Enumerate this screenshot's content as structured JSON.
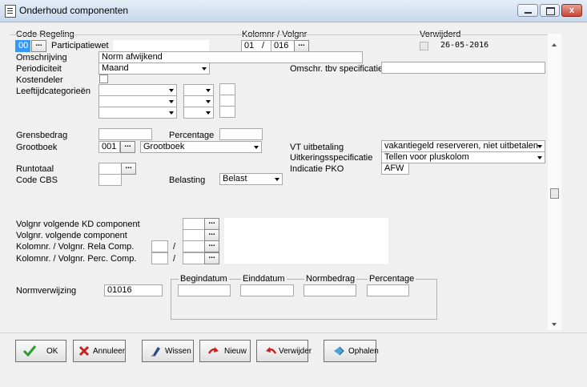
{
  "window": {
    "title": "Onderhoud componenten",
    "close_glyph": "x"
  },
  "header": {
    "code_regeling_label": "Code Regeling",
    "code_value": "00",
    "regeling_name": "Participatiewet",
    "kolomnr_label": "Kolomnr / Volgnr",
    "kolomnr_value": "01",
    "slash": "/",
    "volgnr_value": "016",
    "verwijderd_label": "Verwijderd",
    "verwijderd_date": "26-05-2016",
    "dots": "..."
  },
  "fields": {
    "omschrijving_label": "Omschrijving",
    "omschrijving_value": "Norm afwijkend",
    "periodiciteit_label": "Periodiciteit",
    "periodiciteit_value": "Maand",
    "omschr_spec_label": "Omschr. tbv specificatie",
    "kostendeler_label": "Kostendeler",
    "leeftijd_label": "Leeftijdcategorieën",
    "grensbedrag_label": "Grensbedrag",
    "percentage_label": "Percentage",
    "grootboek_label": "Grootboek",
    "grootboek_code": "001",
    "grootboek_value": "Grootboek",
    "vt_label": "VT uitbetaling",
    "vt_value": "vakantiegeld reserveren, niet uitbetalen",
    "uitk_label": "Uitkeringsspecificatie",
    "uitk_value": "Tellen voor pluskolom",
    "pko_label": "Indicatie PKO",
    "pko_value": "AFW",
    "runtotaal_label": "Runtotaal",
    "code_cbs_label": "Code CBS",
    "belasting_label": "Belasting",
    "belasting_value": "Belast"
  },
  "volgnr": {
    "kd_label": "Volgnr volgende KD component",
    "volgende_label": "Volgnr. volgende component",
    "rela_label": "Kolomnr. / Volgnr. Rela Comp.",
    "perc_label": "Kolomnr. / Volgnr. Perc. Comp.",
    "slash": "/"
  },
  "norm": {
    "label": "Normverwijzing",
    "value": "01016",
    "begindatum": "Begindatum",
    "einddatum": "Einddatum",
    "normbedrag": "Normbedrag",
    "percentage": "Percentage"
  },
  "buttons": {
    "ok": "OK",
    "annuleer": "Annuleer",
    "wissen": "Wissen",
    "nieuw": "Nieuw",
    "verwijder": "Verwijder",
    "ophalen": "Ophalen"
  },
  "colors": {
    "titlebar": "#dbe6f3",
    "ok_check": "#2a9d2a",
    "cancel_x": "#c8201e",
    "accent_red": "#d11f1f"
  }
}
